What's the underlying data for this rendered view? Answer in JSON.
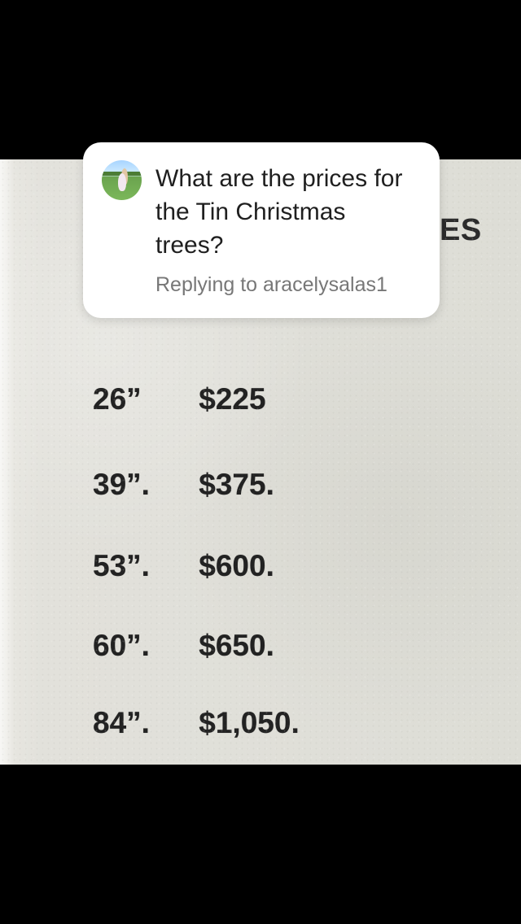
{
  "photo": {
    "header_fragment": "ES",
    "rows": [
      {
        "size": "26”",
        "price": "$225"
      },
      {
        "size": "39”.",
        "price": "$375."
      },
      {
        "size": "53”.",
        "price": "$600."
      },
      {
        "size": "60”.",
        "price": "$650."
      },
      {
        "size": "84”.",
        "price": "$1,050."
      }
    ]
  },
  "reply_card": {
    "question": "What are the prices for the Tin Christmas trees?",
    "replying_to": "Replying to aracelysalas1"
  },
  "colors": {
    "background": "#000000",
    "card": "#ffffff",
    "paper": "#e2e1db",
    "text": "#222222",
    "muted": "#777777"
  }
}
